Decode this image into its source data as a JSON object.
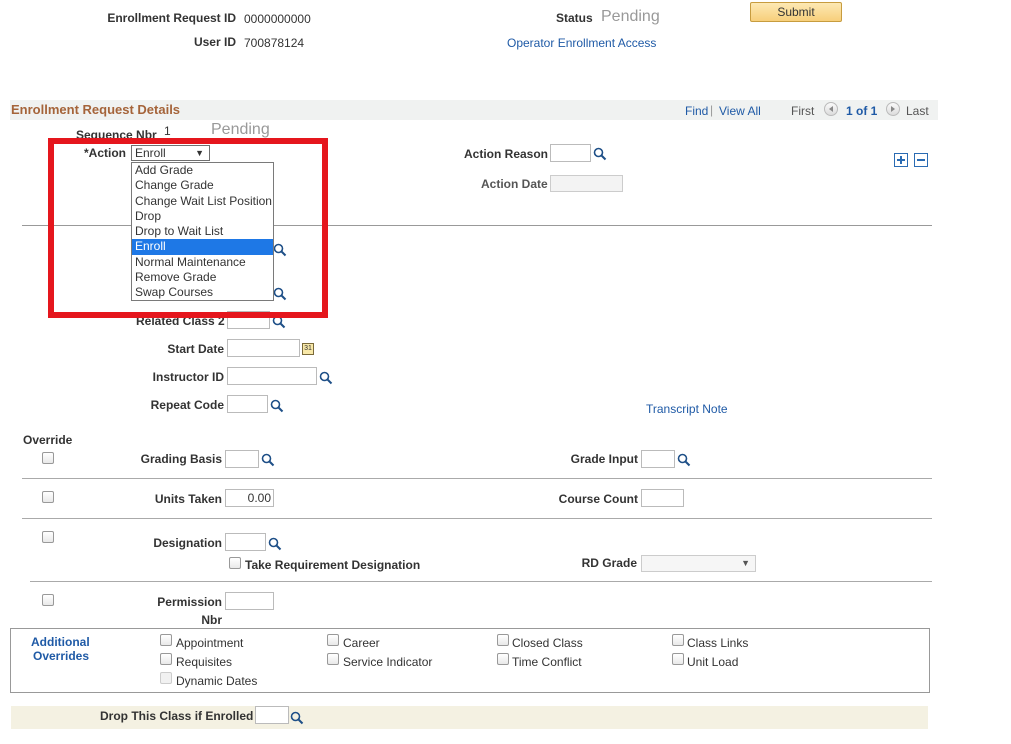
{
  "header": {
    "enrollment_request_id_label": "Enrollment Request ID",
    "enrollment_request_id": "0000000000",
    "user_id_label": "User ID",
    "user_id": "700878124",
    "status_label": "Status",
    "status_value": "Pending",
    "operator_link": "Operator Enrollment Access",
    "submit_label": "Submit"
  },
  "section": {
    "title": "Enrollment Request Details",
    "find": "Find",
    "separator": "|",
    "view_all": "View All",
    "first": "First",
    "count": "1 of 1",
    "last": "Last"
  },
  "details": {
    "seq_label": "Sequence Nbr",
    "seq_value": "1",
    "status_value": "Pending",
    "action_label": "*Action",
    "action_value": "Enroll",
    "action_reason_label": "Action Reason",
    "action_date_label": "Action Date"
  },
  "action_options": [
    "Add Grade",
    "Change Grade",
    "Change Wait List Position",
    "Drop",
    "Drop to Wait List",
    "Enroll",
    "Normal Maintenance",
    "Remove Grade",
    "Swap Courses"
  ],
  "class_fields": {
    "related_class_2": "Related Class 2",
    "start_date": "Start Date",
    "instructor_id": "Instructor ID",
    "repeat_code": "Repeat Code",
    "transcript_note": "Transcript Note"
  },
  "override": {
    "title": "Override",
    "grading_basis": "Grading Basis",
    "grade_input": "Grade Input",
    "units_taken": "Units Taken",
    "units_value": "0.00",
    "course_count": "Course Count",
    "designation": "Designation",
    "take_req": "Take Requirement Designation",
    "rd_grade": "RD Grade",
    "permission": "Permission",
    "nbr": "Nbr"
  },
  "additional": {
    "title_line1": "Additional",
    "title_line2": "Overrides",
    "items": [
      "Appointment",
      "Career",
      "Closed Class",
      "Class Links",
      "Requisites",
      "Service Indicator",
      "Time Conflict",
      "Unit Load",
      "Dynamic Dates"
    ]
  },
  "drop_class": {
    "label": "Drop This Class if Enrolled"
  },
  "icons": {
    "lookup": "magnifier-icon",
    "calendar": "calendar-icon",
    "nav_prev": "arrow-left-icon",
    "nav_next": "arrow-right-icon",
    "add_row": "plus-icon",
    "delete_row": "minus-icon"
  },
  "colors": {
    "section_title": "#a5643a",
    "link": "#1f5aa6",
    "highlight": "#e5161d",
    "selected_option": "#1e78e6"
  }
}
